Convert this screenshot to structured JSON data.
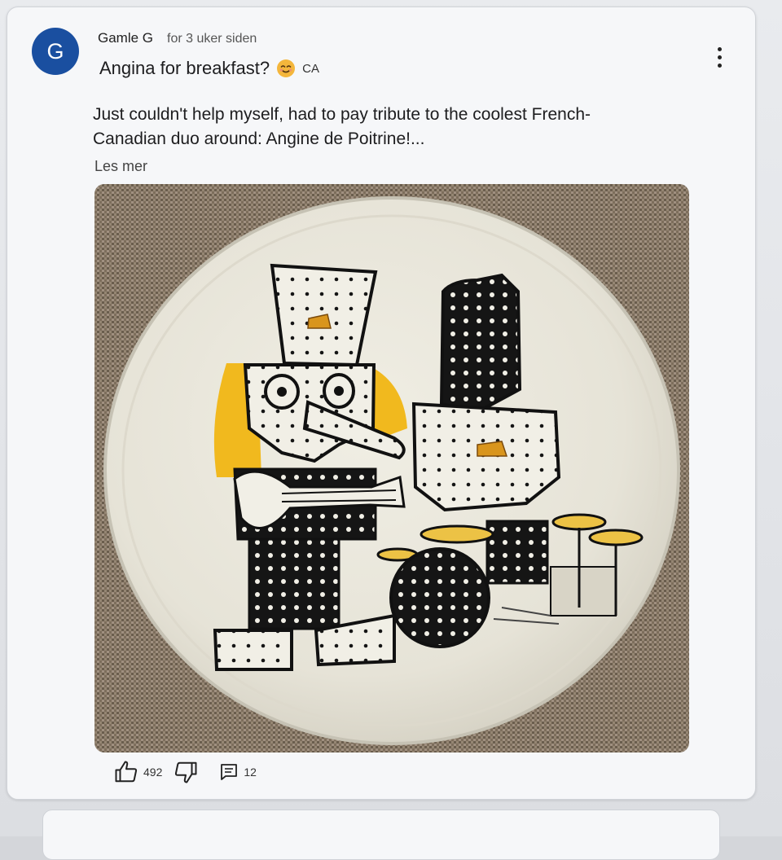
{
  "post": {
    "avatar_letter": "G",
    "author": "Gamle G",
    "time": "for 3 uker siden",
    "title": "Angina for breakfast?",
    "title_emoji": "smiling-face-emoji",
    "title_flag": "CA",
    "body_line1": "Just couldn't help myself, had to pay tribute to the coolest French-",
    "body_line2": "Canadian duo around: Angine de Poitrine!...",
    "read_more": "Les mer",
    "image_icon": "painted-plate-photo",
    "likes": "492",
    "comments": "12"
  },
  "icons": {
    "more": "more-vert-icon",
    "like": "thumb-up-icon",
    "dislike": "thumb-down-icon",
    "comment": "comment-icon"
  },
  "colors": {
    "avatar": "#1a4fa0",
    "card": "#f6f7f9",
    "text": "#1d1d1f"
  }
}
